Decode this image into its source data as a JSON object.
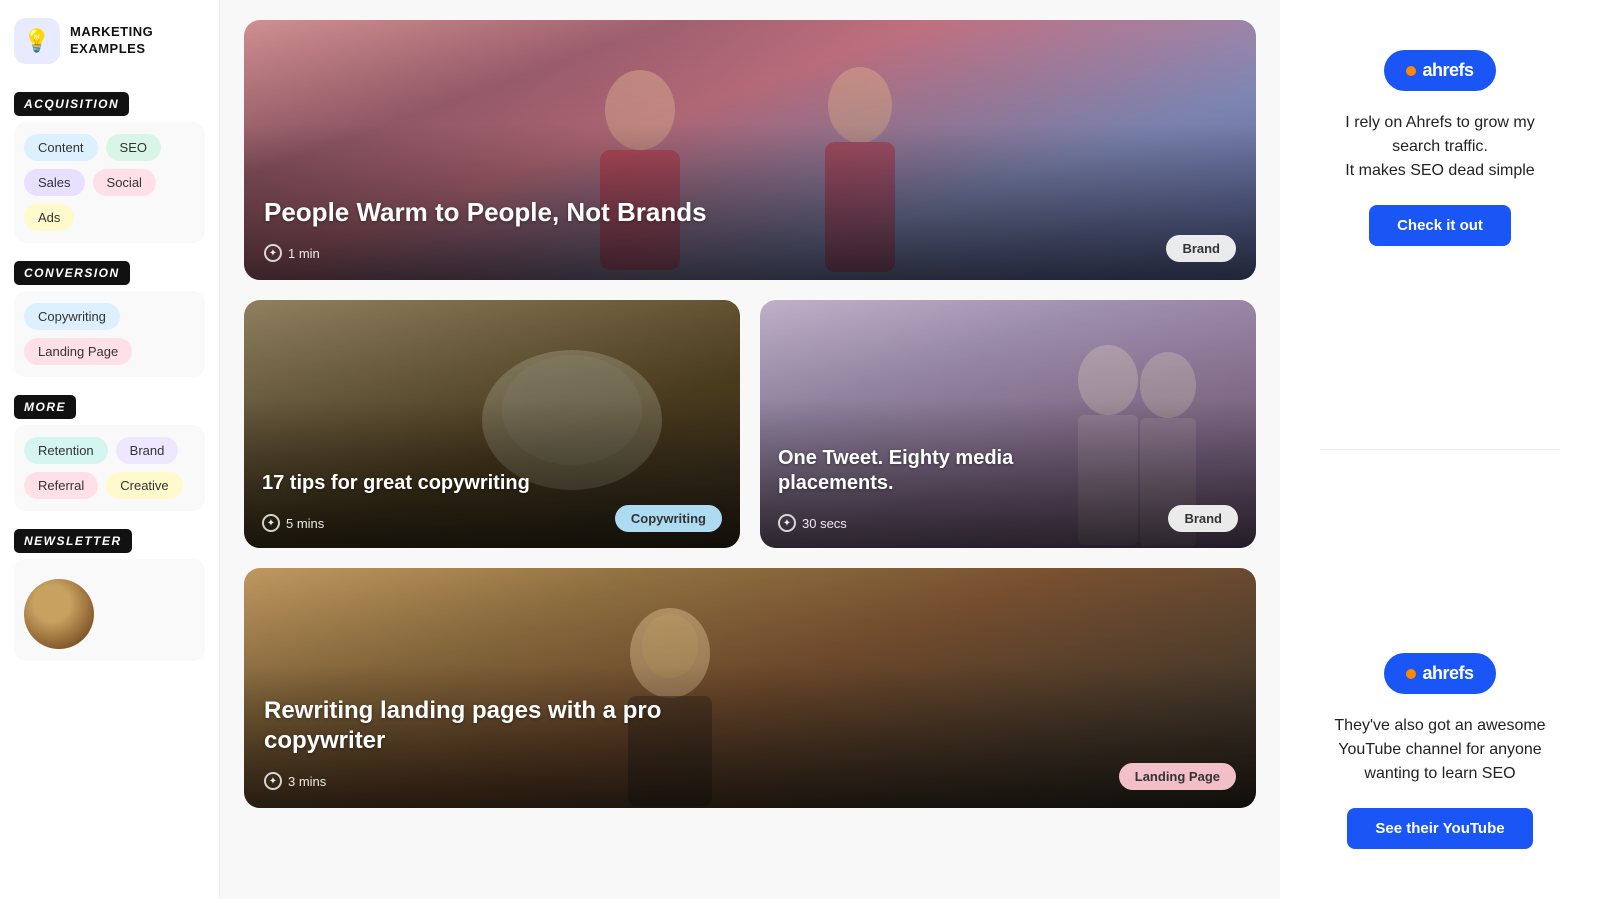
{
  "logo": {
    "icon": "💡",
    "line1": "MARKETING",
    "line2": "EXAMPLES"
  },
  "sidebar": {
    "sections": [
      {
        "label": "ACQUISITION",
        "tags": [
          {
            "text": "Content",
            "color": "blue"
          },
          {
            "text": "SEO",
            "color": "green"
          },
          {
            "text": "Sales",
            "color": "purple"
          },
          {
            "text": "Social",
            "color": "pink"
          },
          {
            "text": "Ads",
            "color": "yellow"
          }
        ]
      },
      {
        "label": "CONVERSION",
        "tags": [
          {
            "text": "Copywriting",
            "color": "blue"
          },
          {
            "text": "Landing Page",
            "color": "pink"
          }
        ]
      },
      {
        "label": "MORE",
        "tags": [
          {
            "text": "Retention",
            "color": "mint"
          },
          {
            "text": "Brand",
            "color": "lavender"
          },
          {
            "text": "Referral",
            "color": "pink"
          },
          {
            "text": "Creative",
            "color": "yellow"
          }
        ]
      },
      {
        "label": "NEWSLETTER",
        "tags": []
      }
    ]
  },
  "cards": [
    {
      "id": "card-1",
      "title": "People Warm to People, Not Brands",
      "time": "1 min",
      "badge": "Brand",
      "badge_color": "white"
    },
    {
      "id": "card-2",
      "title": "17 tips for great copywriting",
      "time": "5 mins",
      "badge": "Copywriting",
      "badge_color": "blue"
    },
    {
      "id": "card-3",
      "title": "One Tweet. Eighty media placements.",
      "time": "30 secs",
      "badge": "Brand",
      "badge_color": "white"
    },
    {
      "id": "card-4",
      "title": "Rewriting landing pages with a pro copywriter",
      "time": "3 mins",
      "badge": "Landing Page",
      "badge_color": "pink"
    }
  ],
  "ads": [
    {
      "id": "ad-1",
      "logo_text": "ahrefs",
      "description": "I rely on Ahrefs to grow my search traffic.\nIt makes SEO dead simple",
      "button_label": "Check it out"
    },
    {
      "id": "ad-2",
      "logo_text": "ahrefs",
      "description": "They've also got an awesome YouTube channel for anyone wanting to learn SEO",
      "button_label": "See their YouTube"
    }
  ]
}
